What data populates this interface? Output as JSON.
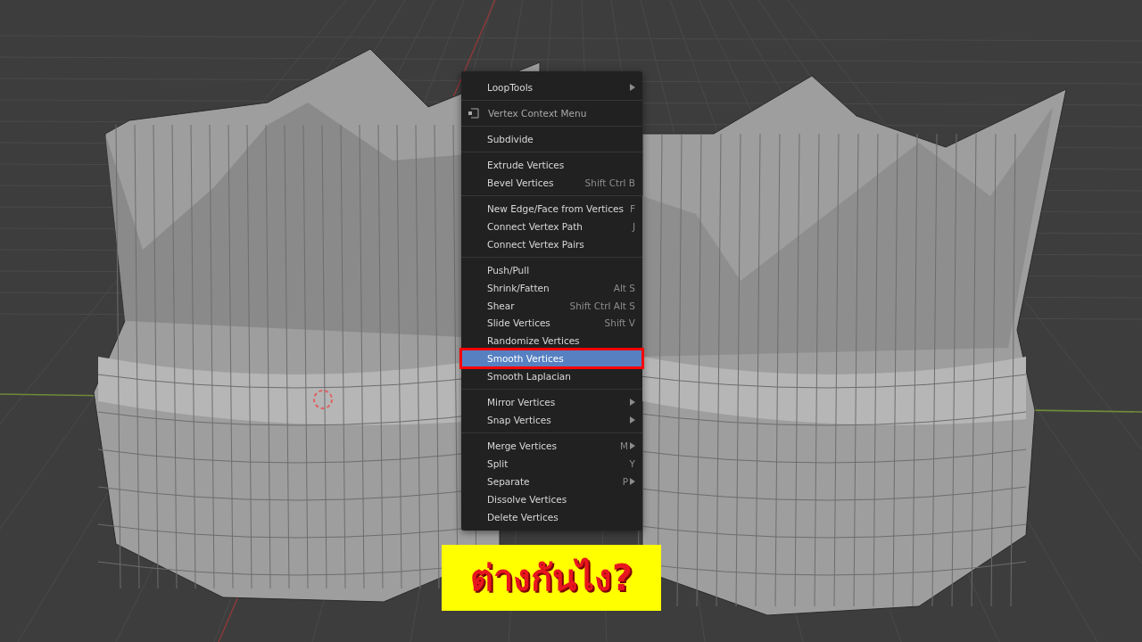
{
  "menu": {
    "sections": [
      {
        "items": [
          {
            "kind": "item",
            "label": "LoopTools",
            "submenu": true,
            "selected": false
          }
        ]
      },
      {
        "items": [
          {
            "kind": "header",
            "label": "Vertex Context Menu"
          }
        ]
      },
      {
        "items": [
          {
            "kind": "item",
            "label": "Subdivide",
            "submenu": false,
            "selected": false
          }
        ]
      },
      {
        "items": [
          {
            "kind": "item",
            "label": "Extrude Vertices",
            "submenu": false,
            "selected": false
          },
          {
            "kind": "item",
            "label": "Bevel Vertices",
            "shortcut": "Shift Ctrl B",
            "submenu": false,
            "selected": false
          }
        ]
      },
      {
        "items": [
          {
            "kind": "item",
            "label": "New Edge/Face from Vertices",
            "shortcut": "F",
            "submenu": false,
            "selected": false
          },
          {
            "kind": "item",
            "label": "Connect Vertex Path",
            "shortcut": "J",
            "submenu": false,
            "selected": false
          },
          {
            "kind": "item",
            "label": "Connect Vertex Pairs",
            "submenu": false,
            "selected": false
          }
        ]
      },
      {
        "items": [
          {
            "kind": "item",
            "label": "Push/Pull",
            "submenu": false,
            "selected": false
          },
          {
            "kind": "item",
            "label": "Shrink/Fatten",
            "shortcut": "Alt S",
            "submenu": false,
            "selected": false
          },
          {
            "kind": "item",
            "label": "Shear",
            "shortcut": "Shift Ctrl Alt S",
            "submenu": false,
            "selected": false
          },
          {
            "kind": "item",
            "label": "Slide Vertices",
            "shortcut": "Shift V",
            "submenu": false,
            "selected": false
          },
          {
            "kind": "item",
            "label": "Randomize Vertices",
            "submenu": false,
            "selected": false
          },
          {
            "kind": "item",
            "label": "Smooth Vertices",
            "submenu": false,
            "selected": true
          },
          {
            "kind": "item",
            "label": "Smooth Laplacian",
            "submenu": false,
            "selected": false
          }
        ]
      },
      {
        "items": [
          {
            "kind": "item",
            "label": "Mirror Vertices",
            "submenu": true,
            "selected": false
          },
          {
            "kind": "item",
            "label": "Snap Vertices",
            "submenu": true,
            "selected": false
          }
        ]
      },
      {
        "items": [
          {
            "kind": "item",
            "label": "Merge Vertices",
            "shortcut": "M",
            "submenu": true,
            "selected": false
          },
          {
            "kind": "item",
            "label": "Split",
            "shortcut": "Y",
            "submenu": false,
            "selected": false
          },
          {
            "kind": "item",
            "label": "Separate",
            "shortcut": "P",
            "submenu": true,
            "selected": false
          },
          {
            "kind": "item",
            "label": "Dissolve Vertices",
            "submenu": false,
            "selected": false
          },
          {
            "kind": "item",
            "label": "Delete Vertices",
            "submenu": false,
            "selected": false
          }
        ]
      }
    ]
  },
  "caption": "ต่างกันไง?"
}
